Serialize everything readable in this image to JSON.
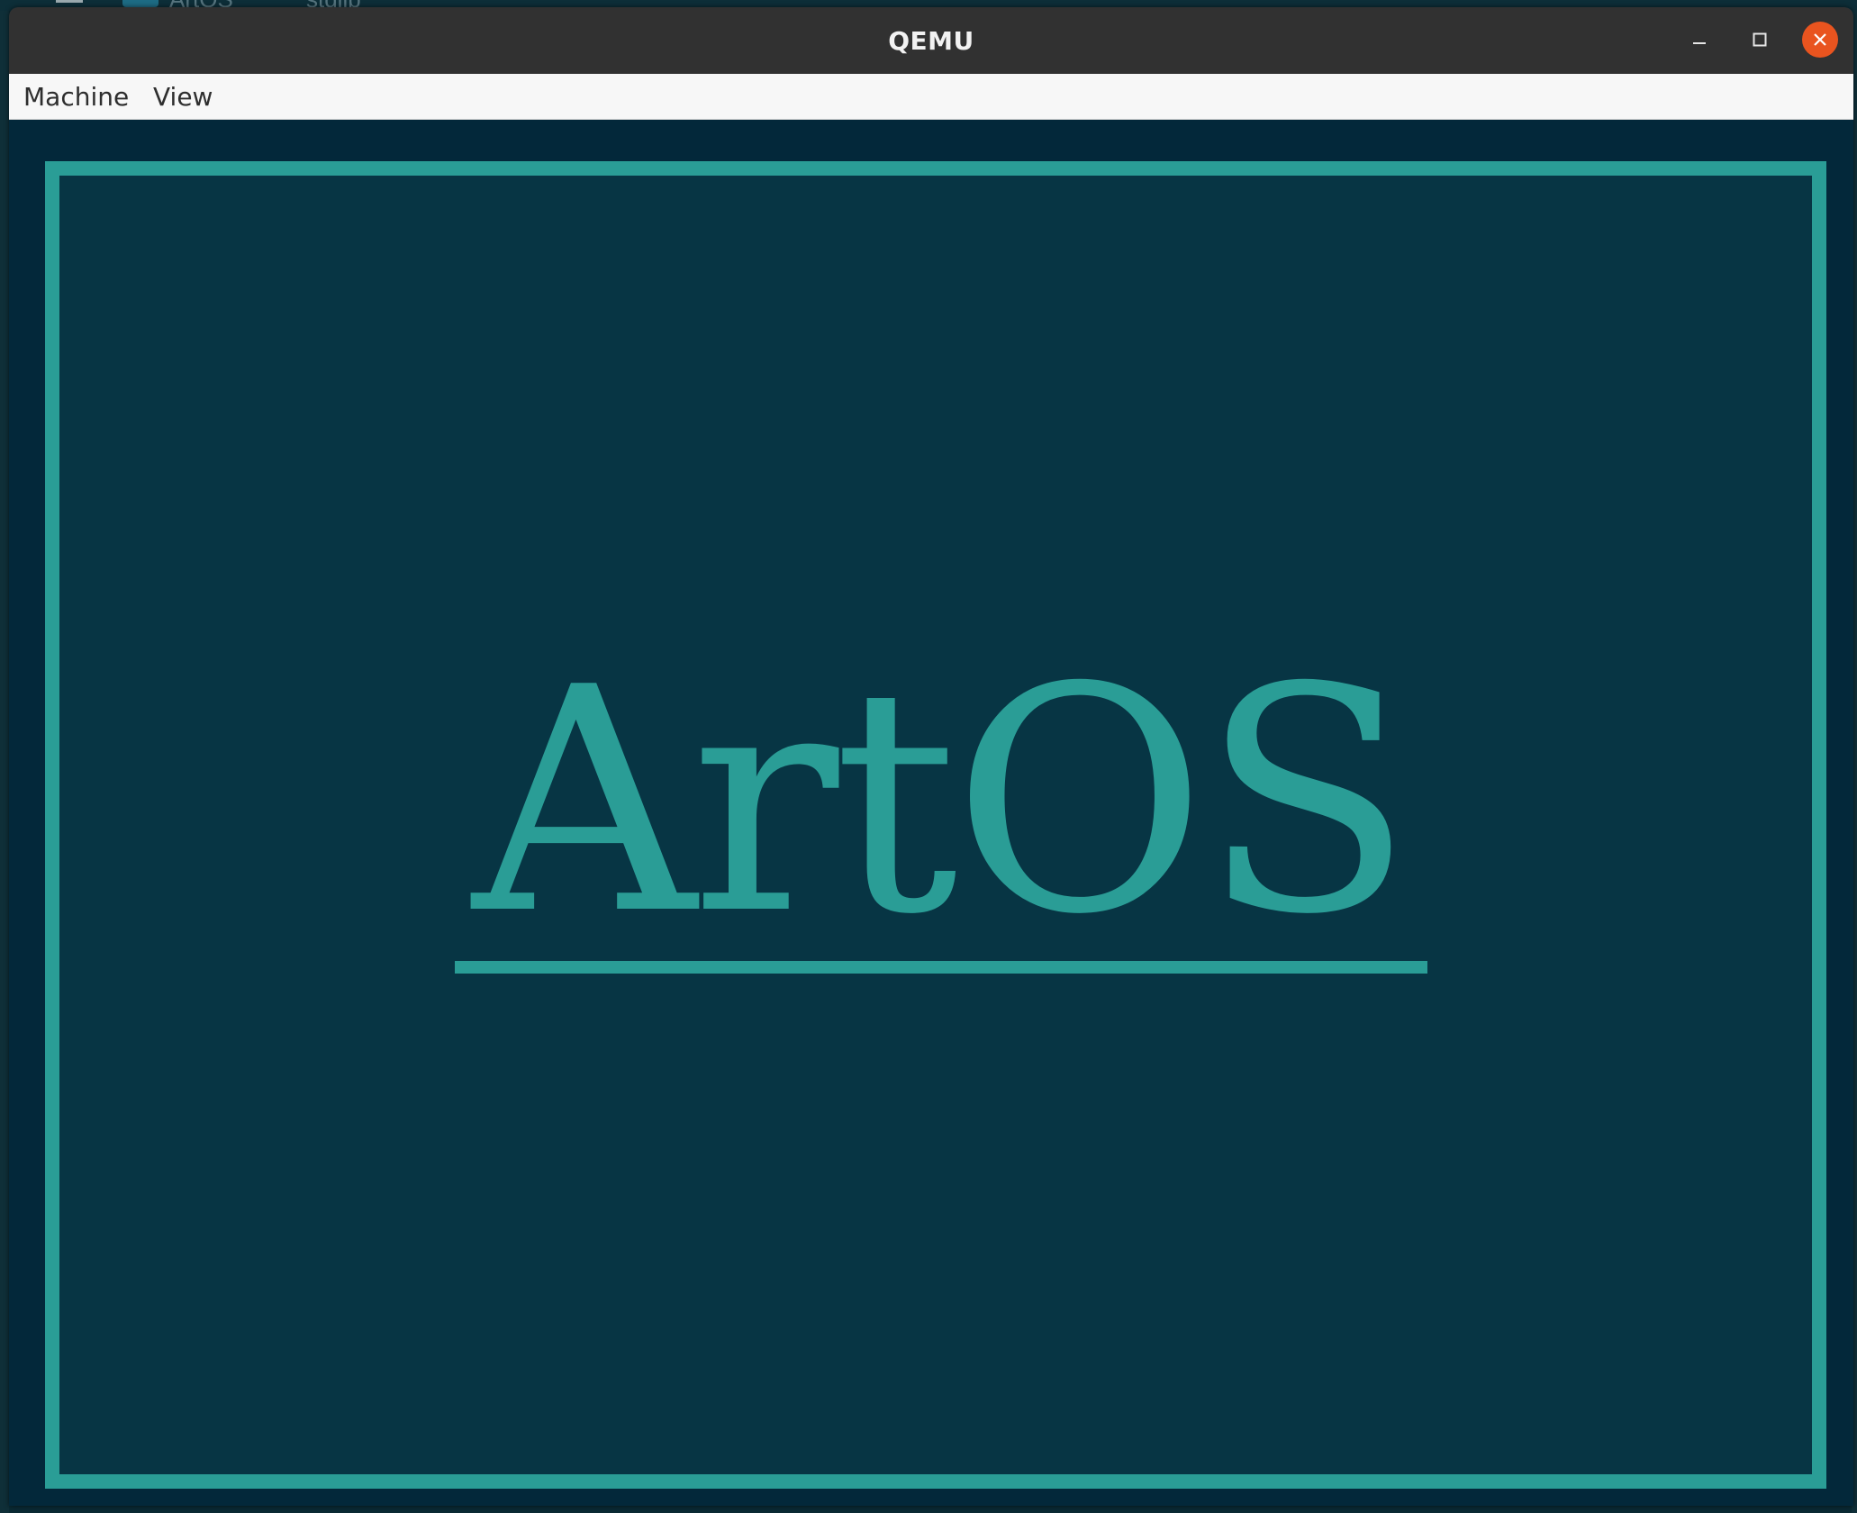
{
  "background": {
    "tab_label": "ArtOS",
    "branch_label": "stdlib"
  },
  "window": {
    "title": "QEMU",
    "controls": {
      "minimize_icon": "minimize-icon",
      "maximize_icon": "maximize-icon",
      "close_icon": "close-icon"
    }
  },
  "menubar": {
    "items": [
      {
        "label": "Machine"
      },
      {
        "label": "View"
      }
    ]
  },
  "guest_display": {
    "logo_text": "ArtOS"
  },
  "colors": {
    "accent": "#2a9d96",
    "guest_background": "#073544",
    "titlebar": "#313131",
    "close_button": "#e9541f",
    "menubar": "#f7f7f7"
  }
}
